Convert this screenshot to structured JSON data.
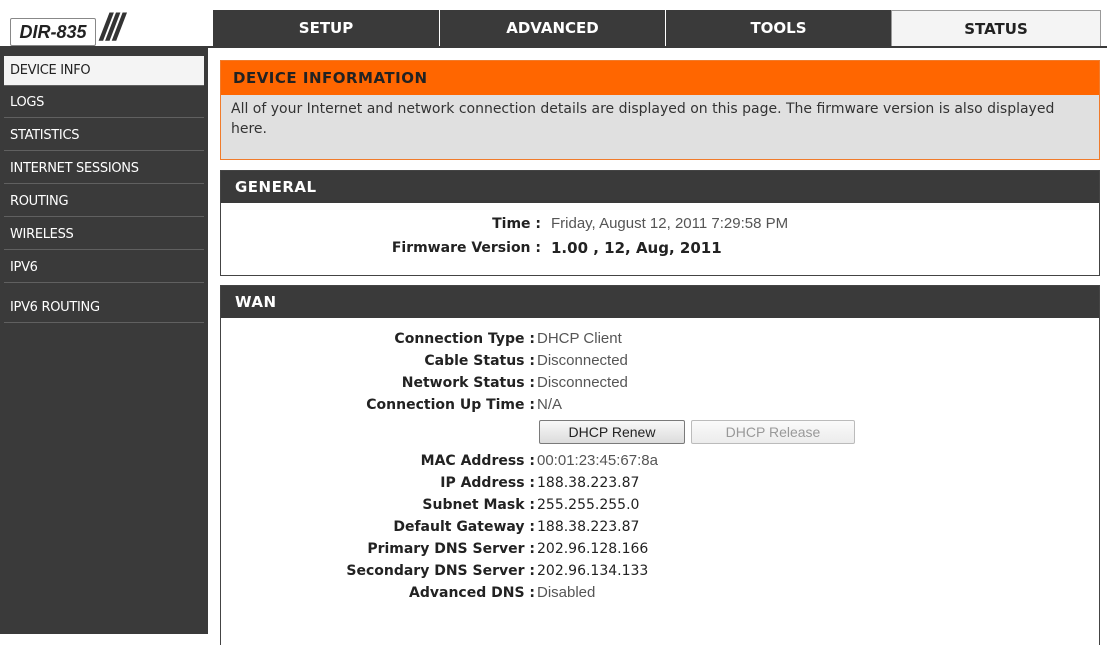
{
  "brand": {
    "model": "DIR-835",
    "slashes": "///"
  },
  "nav": {
    "tabs": [
      {
        "label": "SETUP"
      },
      {
        "label": "ADVANCED"
      },
      {
        "label": "TOOLS"
      },
      {
        "label": "STATUS",
        "active": true
      }
    ]
  },
  "sidebar": {
    "items": [
      {
        "label": "DEVICE INFO",
        "active": true
      },
      {
        "label": "LOGS"
      },
      {
        "label": "STATISTICS"
      },
      {
        "label": "INTERNET SESSIONS"
      },
      {
        "label": "ROUTING"
      },
      {
        "label": "WIRELESS"
      },
      {
        "label": "IPV6"
      },
      {
        "label": "IPV6 ROUTING"
      }
    ]
  },
  "device_info": {
    "title": "DEVICE INFORMATION",
    "description": "All of your Internet and network connection details are displayed on this page. The firmware version is also displayed here."
  },
  "general": {
    "title": "GENERAL",
    "time_label": "Time :",
    "time_value": "Friday, August 12, 2011 7:29:58 PM",
    "firmware_label": "Firmware Version :",
    "firmware_value": "1.00 , 12, Aug, 2011"
  },
  "wan": {
    "title": "WAN",
    "connection_type_label": "Connection Type :",
    "connection_type_value": "DHCP Client",
    "cable_status_label": "Cable Status :",
    "cable_status_value": "Disconnected",
    "network_status_label": "Network Status :",
    "network_status_value": "Disconnected",
    "uptime_label": "Connection Up Time :",
    "uptime_value": "N/A",
    "renew_button": "DHCP Renew",
    "release_button": "DHCP Release",
    "mac_label": "MAC Address :",
    "mac_value": "00:01:23:45:67:8a",
    "ip_label": "IP Address :",
    "ip_value": "188.38.223.87",
    "subnet_label": "Subnet Mask :",
    "subnet_value": "255.255.255.0",
    "gateway_label": "Default Gateway :",
    "gateway_value": "188.38.223.87",
    "dns1_label": "Primary DNS Server :",
    "dns1_value": "202.96.128.166",
    "dns2_label": "Secondary DNS Server :",
    "dns2_value": "202.96.134.133",
    "adv_dns_label": "Advanced DNS :",
    "adv_dns_value": "Disabled"
  },
  "colors": {
    "accent": "#ff6600",
    "header_dark": "#3a3a3a",
    "panel_grey": "#e0e0e0"
  }
}
